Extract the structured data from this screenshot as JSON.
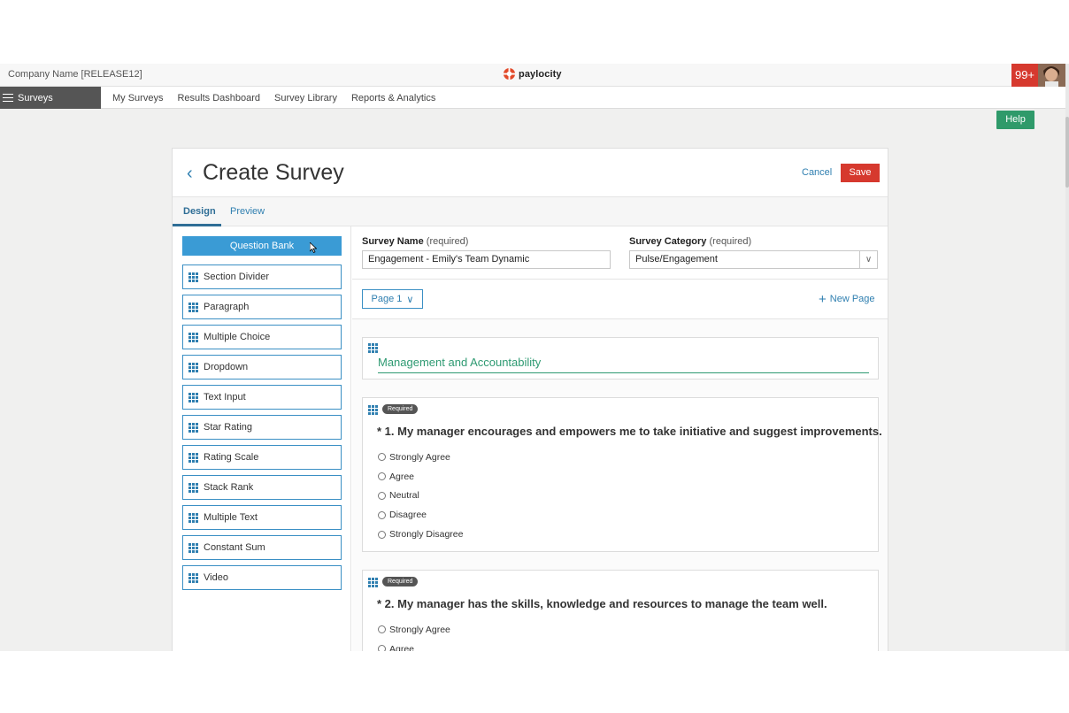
{
  "header": {
    "company": "Company Name [RELEASE12]",
    "logo_text": "paylocity",
    "notifications": "99+"
  },
  "nav": {
    "product": "Surveys",
    "links": [
      "My Surveys",
      "Results Dashboard",
      "Survey Library",
      "Reports & Analytics"
    ]
  },
  "help_label": "Help",
  "page": {
    "title": "Create Survey",
    "cancel": "Cancel",
    "save": "Save",
    "tabs": [
      "Design",
      "Preview"
    ]
  },
  "sidebar": {
    "question_bank": "Question Bank",
    "tools": [
      "Section Divider",
      "Paragraph",
      "Multiple Choice",
      "Dropdown",
      "Text Input",
      "Star Rating",
      "Rating Scale",
      "Stack Rank",
      "Multiple Text",
      "Constant Sum",
      "Video"
    ]
  },
  "form": {
    "survey_name_label": "Survey Name",
    "survey_name_req": "(required)",
    "survey_name_value": "Engagement - Emily's Team Dynamic",
    "category_label": "Survey Category",
    "category_req": "(required)",
    "category_value": "Pulse/Engagement"
  },
  "pages": {
    "current": "Page 1",
    "new_page": "New Page"
  },
  "section_title": "Management and Accountability",
  "questions": [
    {
      "badge": "Required",
      "text": "* 1. My manager encourages and empowers me to take initiative and suggest improvements.",
      "options": [
        "Strongly Agree",
        "Agree",
        "Neutral",
        "Disagree",
        "Strongly Disagree"
      ]
    },
    {
      "badge": "Required",
      "text": "* 2. My manager has the skills, knowledge and resources to manage the team well.",
      "options": [
        "Strongly Agree",
        "Agree"
      ]
    }
  ],
  "colors": {
    "accent_blue": "#3a9bd5",
    "save_red": "#d6392e",
    "help_green": "#2f9a6a",
    "section_green": "#2e9a72"
  }
}
